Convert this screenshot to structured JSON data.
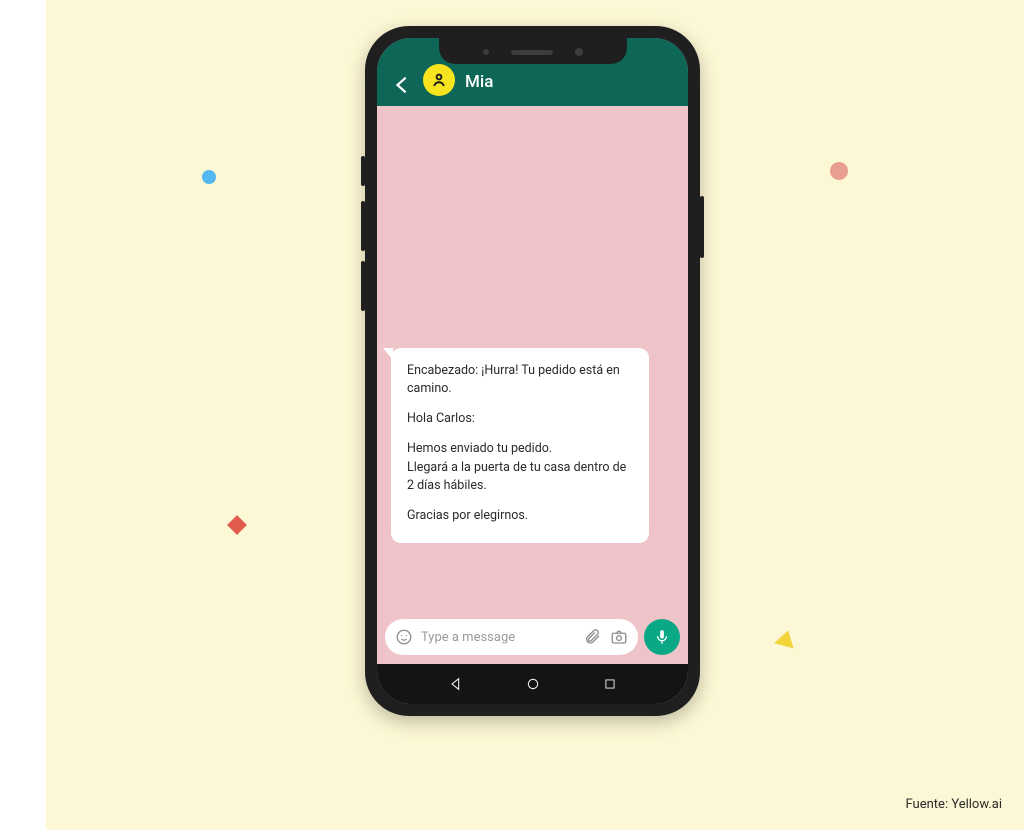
{
  "header": {
    "contact_name": "Mia"
  },
  "message": {
    "header": "Encabezado: ¡Hurra! Tu pedido está en camino.",
    "greeting": "Hola Carlos:",
    "body_line1": "Hemos enviado tu pedido.",
    "body_line2": "Llegará a la puerta de tu casa dentro de 2 días hábiles.",
    "closing": "Gracias por elegirnos."
  },
  "input": {
    "placeholder": "Type a message"
  },
  "credit": "Fuente: Yellow.ai",
  "colors": {
    "canvas_bg": "#fcf7d4",
    "header_bg": "#0e6657",
    "chat_bg": "#efc4c9",
    "avatar_bg": "#f7e41f",
    "mic_bg": "#0aa884"
  }
}
